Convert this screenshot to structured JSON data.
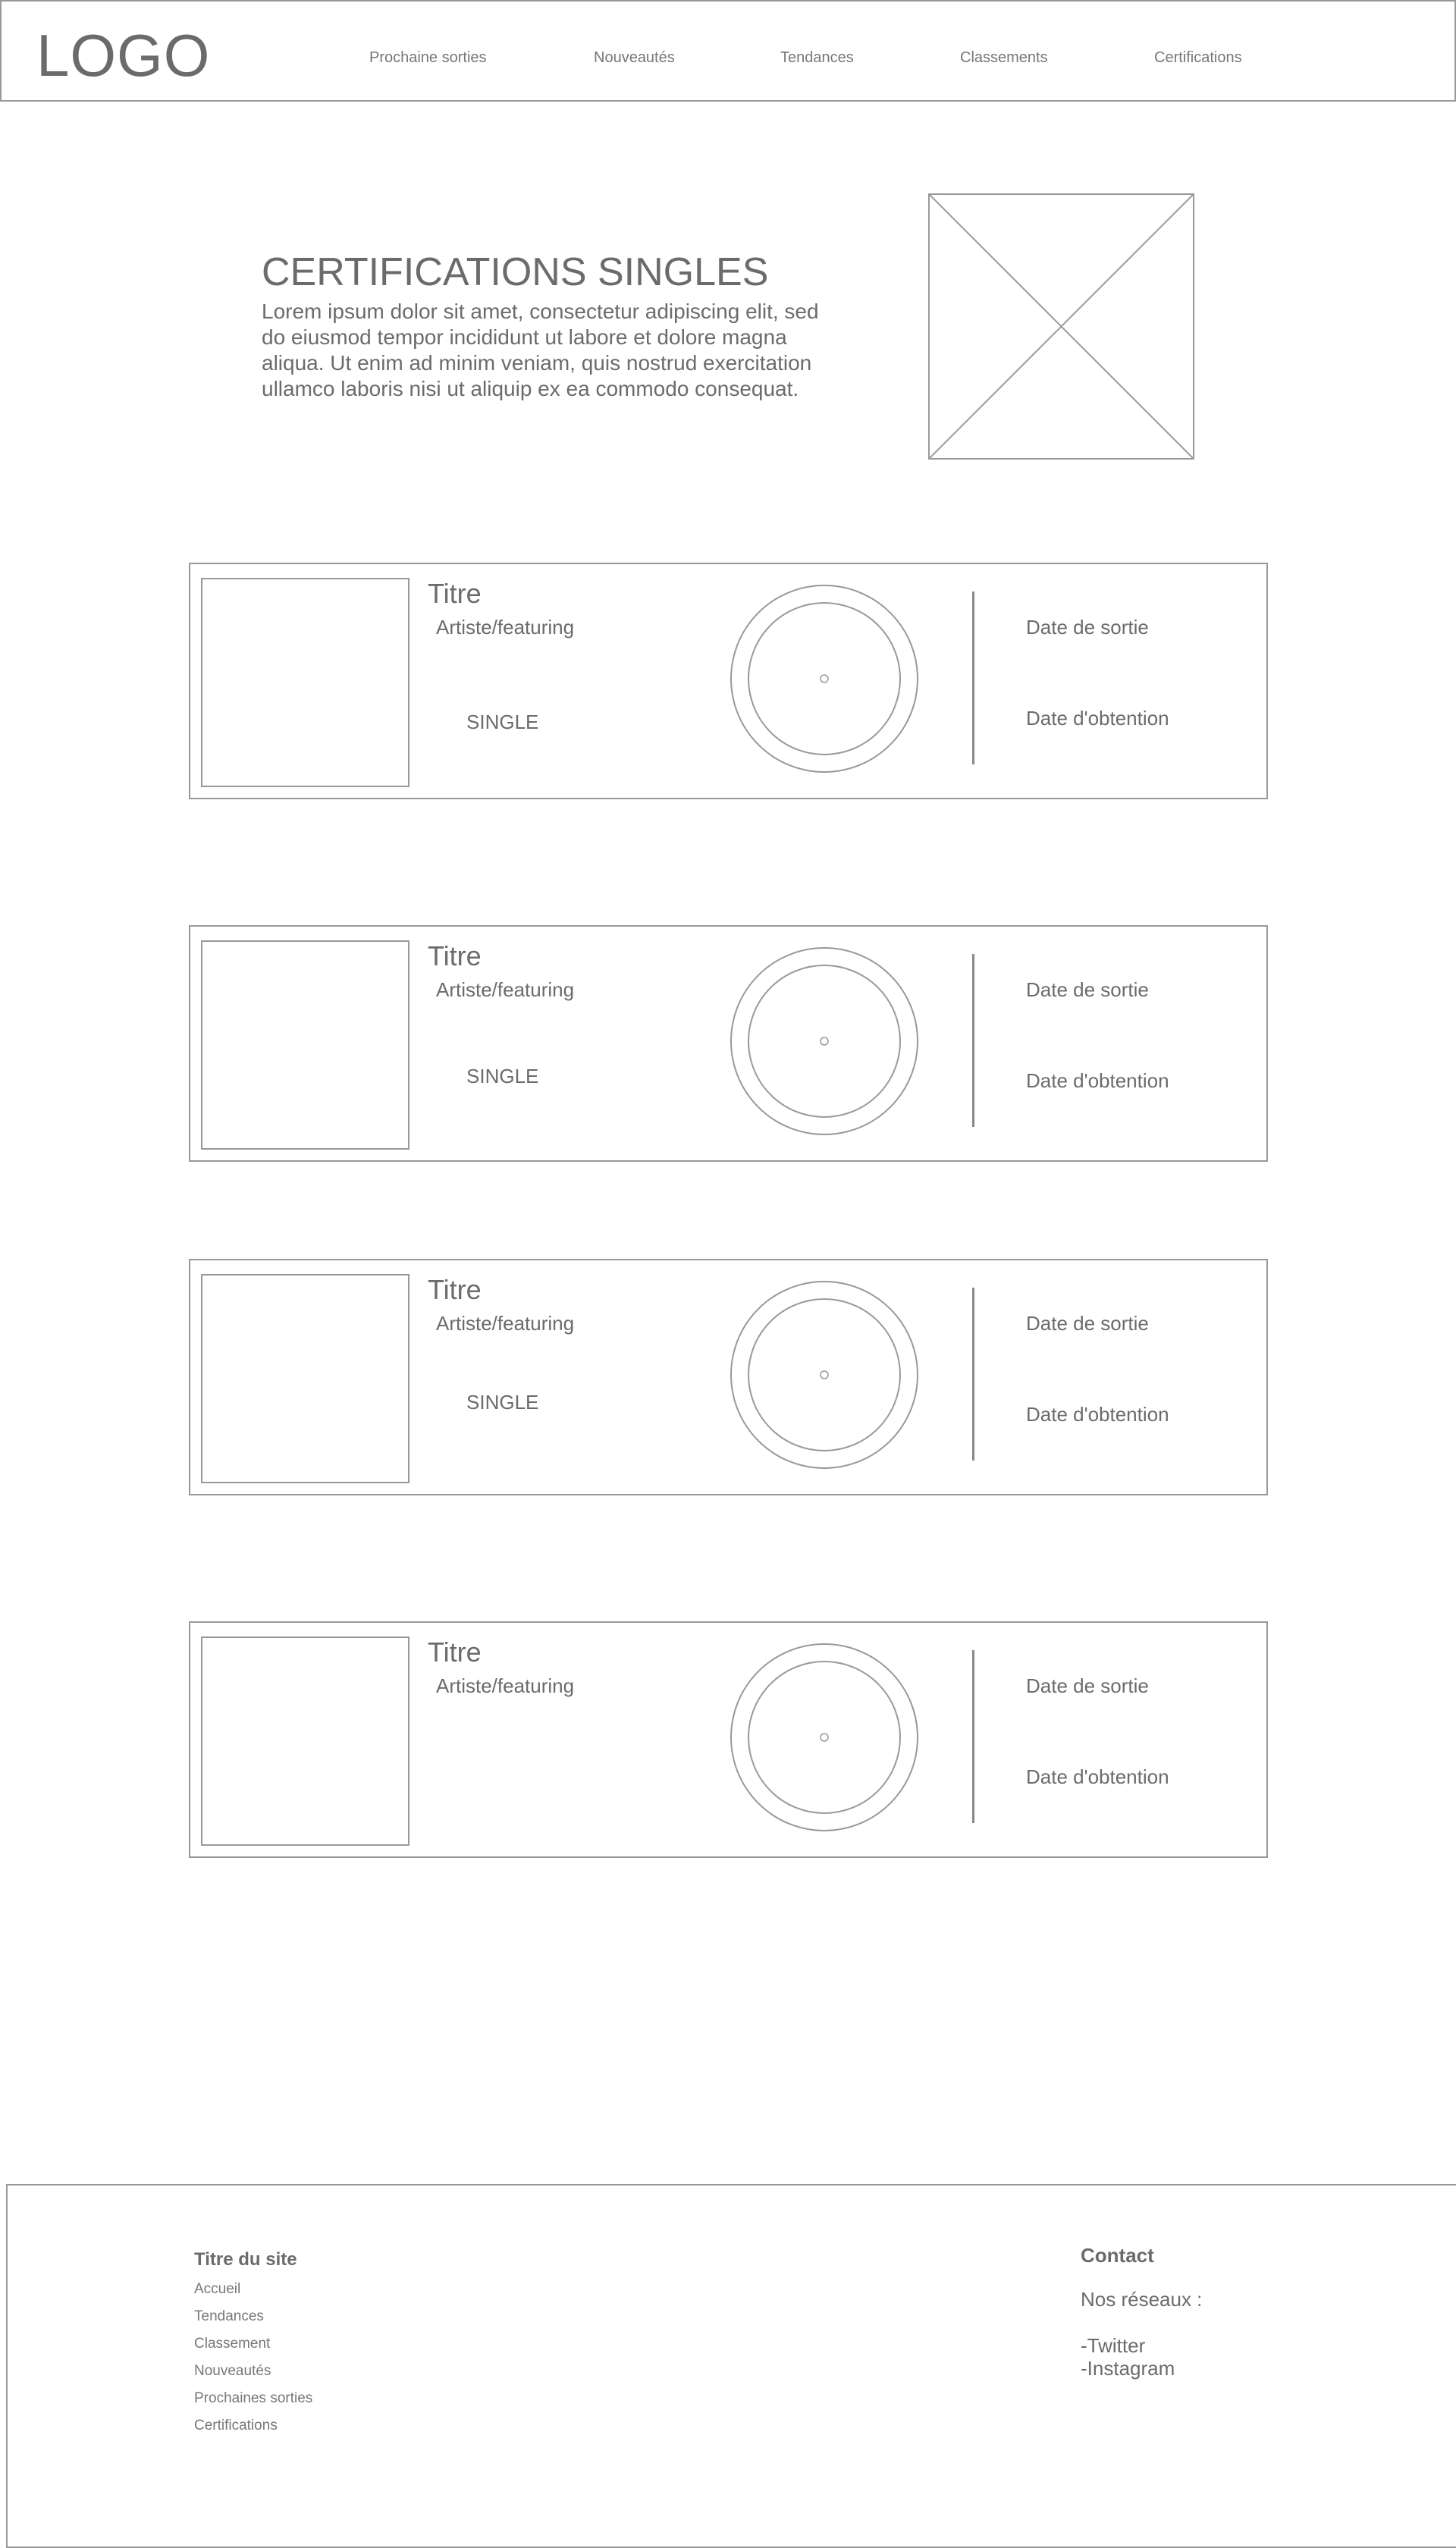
{
  "header": {
    "logo": "LOGO",
    "nav": [
      "Prochaine sorties",
      "Nouveautés",
      "Tendances",
      "Classements",
      "Certifications"
    ]
  },
  "hero": {
    "title": "CERTIFICATIONS SINGLES",
    "text": "Lorem ipsum dolor sit amet, consectetur adipiscing elit, sed do eiusmod tempor incididunt ut labore et dolore magna aliqua. Ut enim ad minim veniam, quis nostrud exercitation ullamco laboris nisi ut aliquip ex ea commodo consequat."
  },
  "cards": [
    {
      "title": "Titre",
      "artist": "Artiste/featuring",
      "type": "SINGLE",
      "release_label": "Date de sortie",
      "obtained_label": "Date d'obtention"
    },
    {
      "title": "Titre",
      "artist": "Artiste/featuring",
      "type": "SINGLE",
      "release_label": "Date de sortie",
      "obtained_label": "Date d'obtention"
    },
    {
      "title": "Titre",
      "artist": "Artiste/featuring",
      "type": "SINGLE",
      "release_label": "Date de sortie",
      "obtained_label": "Date d'obtention"
    },
    {
      "title": "Titre",
      "artist": "Artiste/featuring",
      "release_label": "Date de sortie",
      "obtained_label": "Date d'obtention"
    }
  ],
  "footer": {
    "site_title": "Titre du site",
    "links": [
      "Accueil",
      "Tendances",
      "Classement",
      "Nouveautés",
      "Prochaines sorties",
      "Certifications"
    ],
    "contact": "Contact",
    "networks_label": "Nos réseaux :",
    "networks": [
      "-Twitter",
      "-Instagram"
    ]
  }
}
